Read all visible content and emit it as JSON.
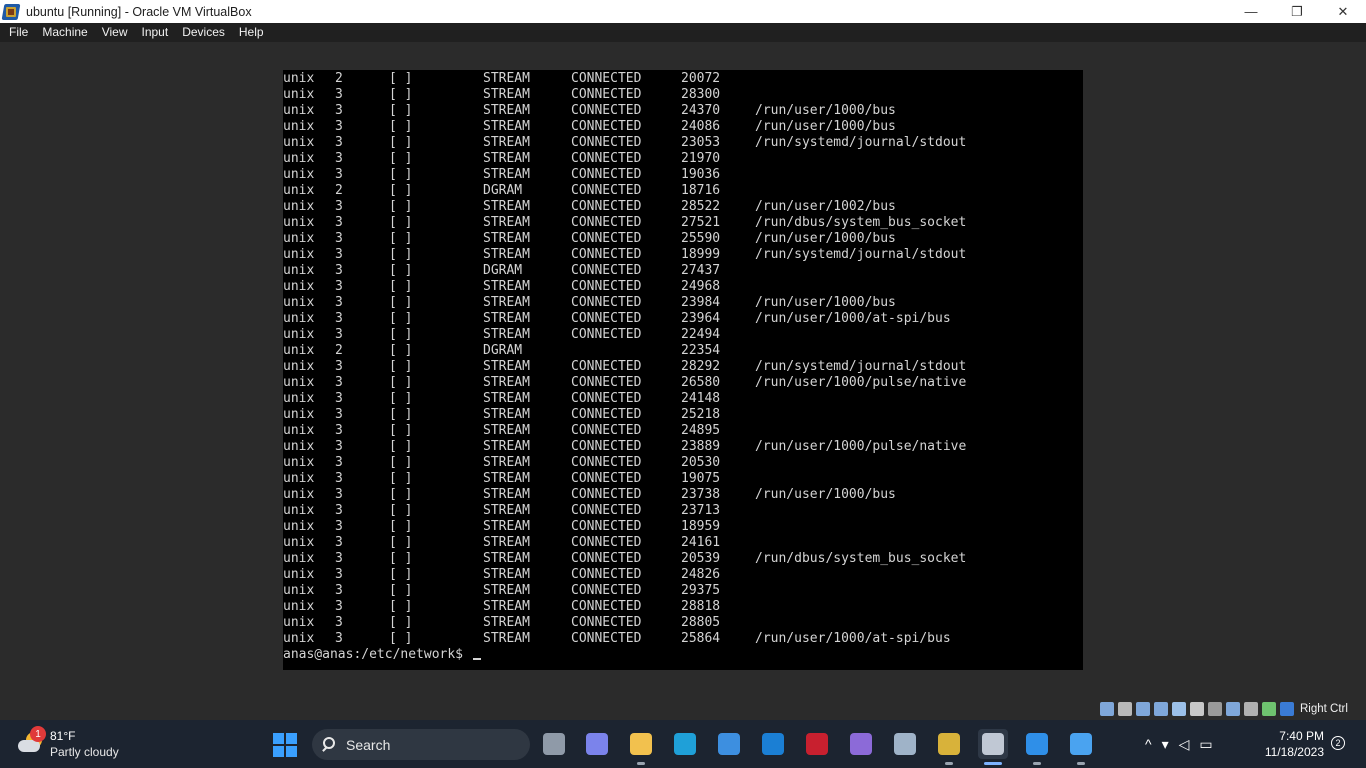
{
  "window": {
    "title": "ubuntu [Running] - Oracle VM VirtualBox",
    "minimize_glyph": "—",
    "restore_glyph": "❐",
    "close_glyph": "✕"
  },
  "menu": {
    "items": [
      "File",
      "Machine",
      "View",
      "Input",
      "Devices",
      "Help"
    ]
  },
  "terminal": {
    "rows": [
      {
        "proto": "unix",
        "refcnt": "2",
        "flags": "[ ]",
        "type": "STREAM",
        "state": "CONNECTED",
        "inode": "20072",
        "path": ""
      },
      {
        "proto": "unix",
        "refcnt": "3",
        "flags": "[ ]",
        "type": "STREAM",
        "state": "CONNECTED",
        "inode": "28300",
        "path": ""
      },
      {
        "proto": "unix",
        "refcnt": "3",
        "flags": "[ ]",
        "type": "STREAM",
        "state": "CONNECTED",
        "inode": "24370",
        "path": "/run/user/1000/bus"
      },
      {
        "proto": "unix",
        "refcnt": "3",
        "flags": "[ ]",
        "type": "STREAM",
        "state": "CONNECTED",
        "inode": "24086",
        "path": "/run/user/1000/bus"
      },
      {
        "proto": "unix",
        "refcnt": "3",
        "flags": "[ ]",
        "type": "STREAM",
        "state": "CONNECTED",
        "inode": "23053",
        "path": "/run/systemd/journal/stdout"
      },
      {
        "proto": "unix",
        "refcnt": "3",
        "flags": "[ ]",
        "type": "STREAM",
        "state": "CONNECTED",
        "inode": "21970",
        "path": ""
      },
      {
        "proto": "unix",
        "refcnt": "3",
        "flags": "[ ]",
        "type": "STREAM",
        "state": "CONNECTED",
        "inode": "19036",
        "path": ""
      },
      {
        "proto": "unix",
        "refcnt": "2",
        "flags": "[ ]",
        "type": "DGRAM",
        "state": "CONNECTED",
        "inode": "18716",
        "path": ""
      },
      {
        "proto": "unix",
        "refcnt": "3",
        "flags": "[ ]",
        "type": "STREAM",
        "state": "CONNECTED",
        "inode": "28522",
        "path": "/run/user/1002/bus"
      },
      {
        "proto": "unix",
        "refcnt": "3",
        "flags": "[ ]",
        "type": "STREAM",
        "state": "CONNECTED",
        "inode": "27521",
        "path": "/run/dbus/system_bus_socket"
      },
      {
        "proto": "unix",
        "refcnt": "3",
        "flags": "[ ]",
        "type": "STREAM",
        "state": "CONNECTED",
        "inode": "25590",
        "path": "/run/user/1000/bus"
      },
      {
        "proto": "unix",
        "refcnt": "3",
        "flags": "[ ]",
        "type": "STREAM",
        "state": "CONNECTED",
        "inode": "18999",
        "path": "/run/systemd/journal/stdout"
      },
      {
        "proto": "unix",
        "refcnt": "3",
        "flags": "[ ]",
        "type": "DGRAM",
        "state": "CONNECTED",
        "inode": "27437",
        "path": ""
      },
      {
        "proto": "unix",
        "refcnt": "3",
        "flags": "[ ]",
        "type": "STREAM",
        "state": "CONNECTED",
        "inode": "24968",
        "path": ""
      },
      {
        "proto": "unix",
        "refcnt": "3",
        "flags": "[ ]",
        "type": "STREAM",
        "state": "CONNECTED",
        "inode": "23984",
        "path": "/run/user/1000/bus"
      },
      {
        "proto": "unix",
        "refcnt": "3",
        "flags": "[ ]",
        "type": "STREAM",
        "state": "CONNECTED",
        "inode": "23964",
        "path": "/run/user/1000/at-spi/bus"
      },
      {
        "proto": "unix",
        "refcnt": "3",
        "flags": "[ ]",
        "type": "STREAM",
        "state": "CONNECTED",
        "inode": "22494",
        "path": ""
      },
      {
        "proto": "unix",
        "refcnt": "2",
        "flags": "[ ]",
        "type": "DGRAM",
        "state": "",
        "inode": "22354",
        "path": ""
      },
      {
        "proto": "unix",
        "refcnt": "3",
        "flags": "[ ]",
        "type": "STREAM",
        "state": "CONNECTED",
        "inode": "28292",
        "path": "/run/systemd/journal/stdout"
      },
      {
        "proto": "unix",
        "refcnt": "3",
        "flags": "[ ]",
        "type": "STREAM",
        "state": "CONNECTED",
        "inode": "26580",
        "path": "/run/user/1000/pulse/native"
      },
      {
        "proto": "unix",
        "refcnt": "3",
        "flags": "[ ]",
        "type": "STREAM",
        "state": "CONNECTED",
        "inode": "24148",
        "path": ""
      },
      {
        "proto": "unix",
        "refcnt": "3",
        "flags": "[ ]",
        "type": "STREAM",
        "state": "CONNECTED",
        "inode": "25218",
        "path": ""
      },
      {
        "proto": "unix",
        "refcnt": "3",
        "flags": "[ ]",
        "type": "STREAM",
        "state": "CONNECTED",
        "inode": "24895",
        "path": ""
      },
      {
        "proto": "unix",
        "refcnt": "3",
        "flags": "[ ]",
        "type": "STREAM",
        "state": "CONNECTED",
        "inode": "23889",
        "path": "/run/user/1000/pulse/native"
      },
      {
        "proto": "unix",
        "refcnt": "3",
        "flags": "[ ]",
        "type": "STREAM",
        "state": "CONNECTED",
        "inode": "20530",
        "path": ""
      },
      {
        "proto": "unix",
        "refcnt": "3",
        "flags": "[ ]",
        "type": "STREAM",
        "state": "CONNECTED",
        "inode": "19075",
        "path": ""
      },
      {
        "proto": "unix",
        "refcnt": "3",
        "flags": "[ ]",
        "type": "STREAM",
        "state": "CONNECTED",
        "inode": "23738",
        "path": "/run/user/1000/bus"
      },
      {
        "proto": "unix",
        "refcnt": "3",
        "flags": "[ ]",
        "type": "STREAM",
        "state": "CONNECTED",
        "inode": "23713",
        "path": ""
      },
      {
        "proto": "unix",
        "refcnt": "3",
        "flags": "[ ]",
        "type": "STREAM",
        "state": "CONNECTED",
        "inode": "18959",
        "path": ""
      },
      {
        "proto": "unix",
        "refcnt": "3",
        "flags": "[ ]",
        "type": "STREAM",
        "state": "CONNECTED",
        "inode": "24161",
        "path": ""
      },
      {
        "proto": "unix",
        "refcnt": "3",
        "flags": "[ ]",
        "type": "STREAM",
        "state": "CONNECTED",
        "inode": "20539",
        "path": "/run/dbus/system_bus_socket"
      },
      {
        "proto": "unix",
        "refcnt": "3",
        "flags": "[ ]",
        "type": "STREAM",
        "state": "CONNECTED",
        "inode": "24826",
        "path": ""
      },
      {
        "proto": "unix",
        "refcnt": "3",
        "flags": "[ ]",
        "type": "STREAM",
        "state": "CONNECTED",
        "inode": "29375",
        "path": ""
      },
      {
        "proto": "unix",
        "refcnt": "3",
        "flags": "[ ]",
        "type": "STREAM",
        "state": "CONNECTED",
        "inode": "28818",
        "path": ""
      },
      {
        "proto": "unix",
        "refcnt": "3",
        "flags": "[ ]",
        "type": "STREAM",
        "state": "CONNECTED",
        "inode": "28805",
        "path": ""
      },
      {
        "proto": "unix",
        "refcnt": "3",
        "flags": "[ ]",
        "type": "STREAM",
        "state": "CONNECTED",
        "inode": "25864",
        "path": "/run/user/1000/at-spi/bus"
      }
    ],
    "prompt": "anas@anas:/etc/network$ "
  },
  "vbox_status": {
    "icons": [
      {
        "name": "optical-drive-icon",
        "color": "#7fa7d9"
      },
      {
        "name": "audio-icon",
        "color": "#b8b8b8"
      },
      {
        "name": "network-icon",
        "color": "#7fa7d9"
      },
      {
        "name": "usb-icon",
        "color": "#7fa7d9"
      },
      {
        "name": "shared-folders-icon",
        "color": "#9cc0e8"
      },
      {
        "name": "display-icon",
        "color": "#c8c8c8"
      },
      {
        "name": "recording-icon",
        "color": "#9a9a9a"
      },
      {
        "name": "guest-additions-icon",
        "color": "#7fa7d9"
      },
      {
        "name": "cpu-icon",
        "color": "#b0b0b0"
      },
      {
        "name": "mouse-integration-icon",
        "color": "#6fc36f"
      },
      {
        "name": "keyboard-icon",
        "color": "#3a7bd5"
      }
    ],
    "host_key": "Right Ctrl"
  },
  "taskbar": {
    "weather": {
      "temp": "81°F",
      "desc": "Partly cloudy",
      "badge": "1"
    },
    "search_label": "Search",
    "apps": [
      {
        "name": "task-view-icon",
        "color": "#8f9aa8",
        "active": false,
        "running": false
      },
      {
        "name": "teams-icon",
        "color": "#7b83eb",
        "active": false,
        "running": false
      },
      {
        "name": "file-explorer-icon",
        "color": "#f2c14e",
        "active": false,
        "running": true
      },
      {
        "name": "edge-icon",
        "color": "#1fa0d8",
        "active": false,
        "running": false
      },
      {
        "name": "store-icon",
        "color": "#3d8fe0",
        "active": false,
        "running": false
      },
      {
        "name": "launcher-l-icon",
        "color": "#1b7fd4",
        "active": false,
        "running": false
      },
      {
        "name": "mcafee-icon",
        "color": "#c8202f",
        "active": false,
        "running": false
      },
      {
        "name": "vs-icon",
        "color": "#8c6ad8",
        "active": false,
        "running": false
      },
      {
        "name": "box-app-icon",
        "color": "#9fb3c8",
        "active": false,
        "running": false
      },
      {
        "name": "virtualbox-manager-icon",
        "color": "#d8b23a",
        "active": false,
        "running": true
      },
      {
        "name": "virtualbox-vm-icon",
        "color": "#c0c8d4",
        "active": true,
        "running": true
      },
      {
        "name": "browser-app-icon",
        "color": "#2f8fe8",
        "active": false,
        "running": true
      },
      {
        "name": "photos-icon",
        "color": "#4aa3f0",
        "active": false,
        "running": true
      }
    ],
    "tray": {
      "chevron": "^",
      "wifi": "▾",
      "volume": "◁",
      "battery": "▭"
    },
    "time": "7:40 PM",
    "date": "11/18/2023",
    "notifications": "2"
  }
}
